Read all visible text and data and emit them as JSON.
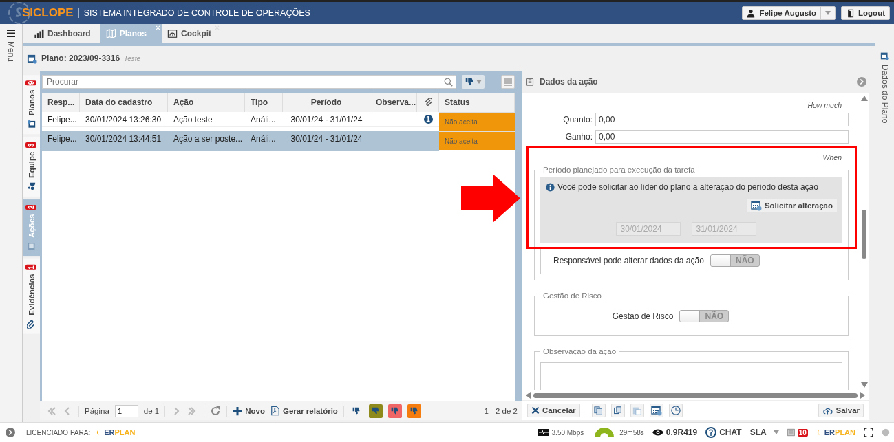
{
  "header": {
    "logo": "SICLOPE",
    "title": "SISTEMA INTEGRADO DE CONTROLE DE OPERAÇÕES",
    "user": "Felipe Augusto",
    "logout": "Logout"
  },
  "menu": {
    "label": "Menu"
  },
  "tabs": [
    {
      "label": "Dashboard",
      "selected": false,
      "closable": false,
      "kind": "chart"
    },
    {
      "label": "Planos",
      "selected": true,
      "closable": true,
      "kind": "map"
    },
    {
      "label": "Cockpit",
      "selected": false,
      "closable": true,
      "kind": "gauge"
    }
  ],
  "plan": {
    "title": "Plano: 2023/09-3316",
    "subtitle": "Teste"
  },
  "side_tabs": [
    {
      "label": "Planos",
      "count": "9",
      "selected": false,
      "kind": "plan"
    },
    {
      "label": "Equipe",
      "count": "3",
      "selected": false,
      "kind": "team"
    },
    {
      "label": "Ações",
      "count": "2",
      "selected": true,
      "kind": "action"
    },
    {
      "label": "Evidências",
      "count": "1",
      "selected": false,
      "kind": "clip"
    }
  ],
  "grid": {
    "search": {
      "placeholder": "Procurar"
    },
    "columns": [
      {
        "label": "Resp...",
        "kind": "text"
      },
      {
        "label": "Data do cadastro",
        "kind": "text"
      },
      {
        "label": "Ação",
        "kind": "text"
      },
      {
        "label": "Tipo",
        "kind": "text"
      },
      {
        "label": "Período",
        "kind": "center"
      },
      {
        "label": "Observa...",
        "kind": "text"
      },
      {
        "kind": "attachment"
      },
      {
        "label": "Status",
        "kind": "text"
      }
    ],
    "rows": [
      {
        "resp": "Felipe...",
        "date": "30/01/2024 13:26:30",
        "action": "Ação teste",
        "type": "Análi...",
        "period": "30/01/24 - 31/01/24",
        "attachments": "1",
        "status": "Não aceita",
        "selected": false
      },
      {
        "resp": "Felipe...",
        "date": "30/01/2024 13:44:51",
        "action": "Ação a ser poste...",
        "type": "Análi...",
        "period": "30/01/24 - 31/01/24",
        "status": "Não aceita",
        "selected": true
      }
    ],
    "pager": {
      "page_label": "Página",
      "page": "1",
      "of": "de 1",
      "new": "Novo",
      "report": "Gerar relatório",
      "range": "1 - 2 de 2"
    },
    "filters": [
      {
        "kind": "plain",
        "color": "#1e4f7d"
      },
      {
        "kind": "filled",
        "color": "#8e8a1c"
      },
      {
        "kind": "filled",
        "color": "#f06565"
      },
      {
        "kind": "filled",
        "color": "#f57c0f"
      }
    ]
  },
  "detail": {
    "title": "Dados da ação",
    "how_much": "How much",
    "fields": [
      {
        "label": "Quanto:",
        "value": "0,00"
      },
      {
        "label": "Ganho:",
        "value": "0,00"
      }
    ],
    "when": "When",
    "period": {
      "legend": "Período planejado para execução da tarefa",
      "info": "Você pode solicitar ao líder do plano a alteração do período desta ação",
      "request": "Solicitar alteração",
      "start": "30/01/2024",
      "end": "31/01/2024",
      "toggle": {
        "label": "Responsável pode alterar dados da ação",
        "on": false,
        "text": "NÃO"
      }
    },
    "risk": {
      "legend": "Gestão de Risco",
      "label": "Gestão de Risco",
      "on": false,
      "text": "NÃO"
    },
    "notes": {
      "legend": "Observação da ação"
    },
    "cancel": "Cancelar",
    "save": "Salvar"
  },
  "right_strip": {
    "label": "Dados do Plano"
  },
  "status_bar": {
    "licensed": "LICENCIADO PARA:",
    "brand": [
      "ER",
      "PLAN"
    ],
    "speed": "3.50 Mbps",
    "timer": "29m58s",
    "version": "0.9R419",
    "chat": "CHAT",
    "sla": "SLA",
    "count": "10",
    "brand_right": [
      "ER",
      "PLAN"
    ]
  }
}
